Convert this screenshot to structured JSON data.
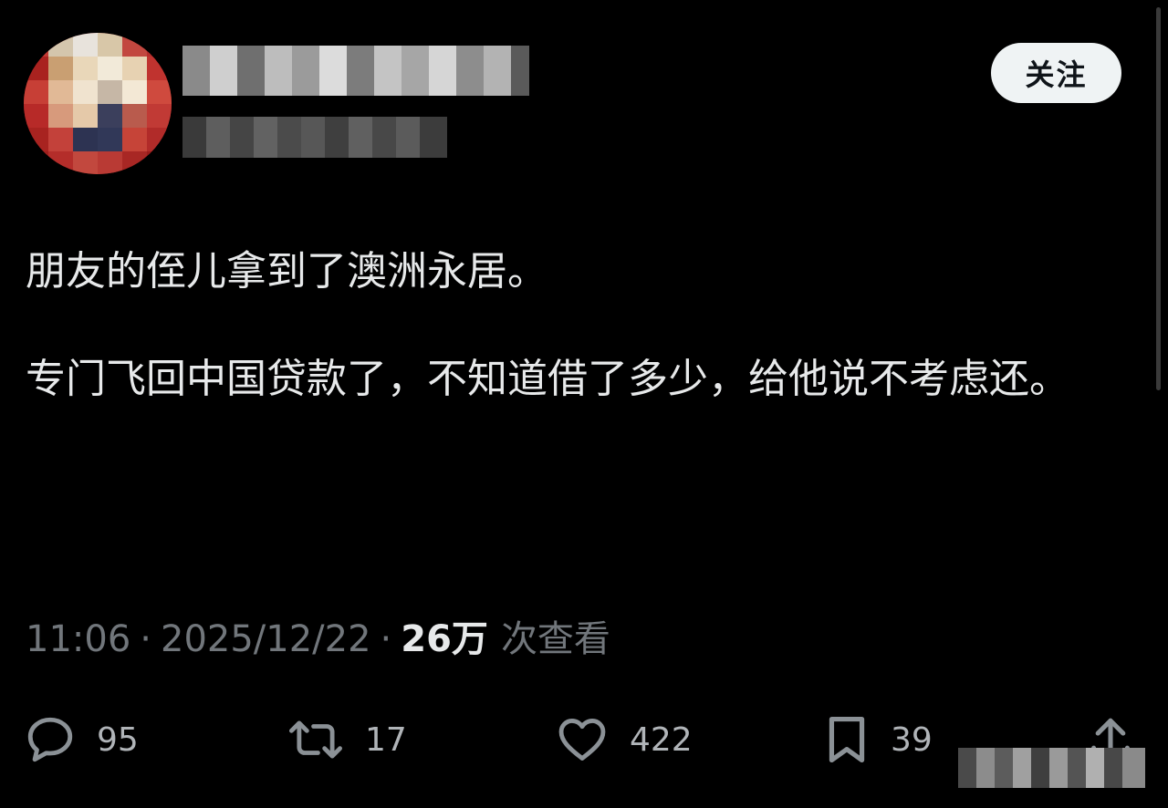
{
  "tweet": {
    "follow_label": "关注",
    "text_line1": "朋友的侄儿拿到了澳洲永居。",
    "text_line2": "专门飞回中国贷款了，不知道借了多少，给他说不考虑还。",
    "time": "11:06",
    "separator": "·",
    "date": "2025/12/22",
    "views_count": "26万",
    "views_label": "次查看"
  },
  "actions": {
    "reply_count": "95",
    "retweet_count": "17",
    "like_count": "422",
    "bookmark_count": "39"
  },
  "icons": {
    "reply": "reply-icon",
    "retweet": "retweet-icon",
    "like": "heart-icon",
    "bookmark": "bookmark-icon",
    "share": "share-icon"
  },
  "colors": {
    "background": "#000000",
    "text": "#e7e9ea",
    "muted": "#71767b",
    "follow_button_bg": "#eff3f4"
  }
}
